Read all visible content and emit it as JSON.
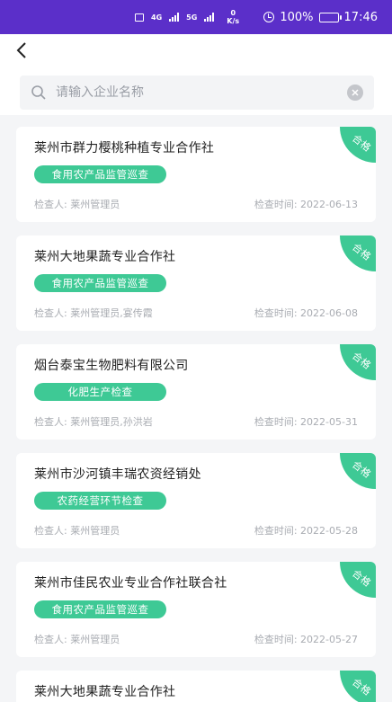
{
  "status_bar": {
    "net_label_1": "4G",
    "net_label_2": "5G",
    "speed_value": "0",
    "speed_unit": "K/s",
    "battery": "100%",
    "time": "17:46"
  },
  "search": {
    "placeholder": "请输入企业名称",
    "value": ""
  },
  "labels": {
    "inspector_prefix": "检查人: ",
    "time_prefix": "检查时间: "
  },
  "colors": {
    "status_bar": "#5b2fc9",
    "accent_green": "#3ec995"
  },
  "records": [
    {
      "company": "莱州市群力樱桃种植专业合作社",
      "category": "食用农产品监管巡查",
      "inspector": "检查人:  莱州管理员",
      "date": "检查时间:  2022-06-13",
      "result": "合格"
    },
    {
      "company": "莱州大地果蔬专业合作社",
      "category": "食用农产品监管巡查",
      "inspector": "检查人:  莱州管理员,宴传霞",
      "date": "检查时间:  2022-06-08",
      "result": "合格"
    },
    {
      "company": "烟台泰宝生物肥料有限公司",
      "category": "化肥生产检查",
      "inspector": "检查人:  莱州管理员,孙洪岩",
      "date": "检查时间:  2022-05-31",
      "result": "合格"
    },
    {
      "company": "莱州市沙河镇丰瑞农资经销处",
      "category": "农药经营环节检查",
      "inspector": "检查人:  莱州管理员",
      "date": "检查时间:  2022-05-28",
      "result": "合格"
    },
    {
      "company": "莱州市佳民农业专业合作社联合社",
      "category": "食用农产品监管巡查",
      "inspector": "检查人:  莱州管理员",
      "date": "检查时间:  2022-05-27",
      "result": "合格"
    },
    {
      "company": "莱州大地果蔬专业合作社",
      "result": "合格"
    }
  ]
}
